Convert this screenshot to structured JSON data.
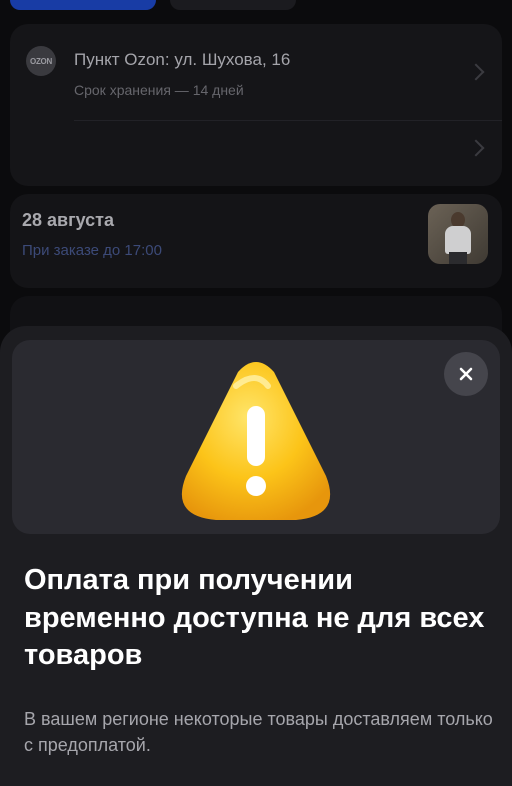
{
  "pickup": {
    "logo_text": "OZON",
    "address": "Пункт Ozon: ул. Шухова, 16",
    "storage": "Срок хранения — 14 дней"
  },
  "delivery": {
    "date": "28 августа",
    "order_note": "При заказе до 17:00"
  },
  "sheet": {
    "title": "Оплата при получении временно доступна не для всех товаров",
    "description": "В вашем регионе некоторые товары доставляем только с предоплатой."
  },
  "icons": {
    "close": "close-icon",
    "warning": "warning-icon",
    "chevron": "chevron-right-icon"
  },
  "colors": {
    "accent": "#1d4ed8",
    "warning_yellow": "#f7c21a",
    "sheet_bg": "#1d1d21"
  }
}
